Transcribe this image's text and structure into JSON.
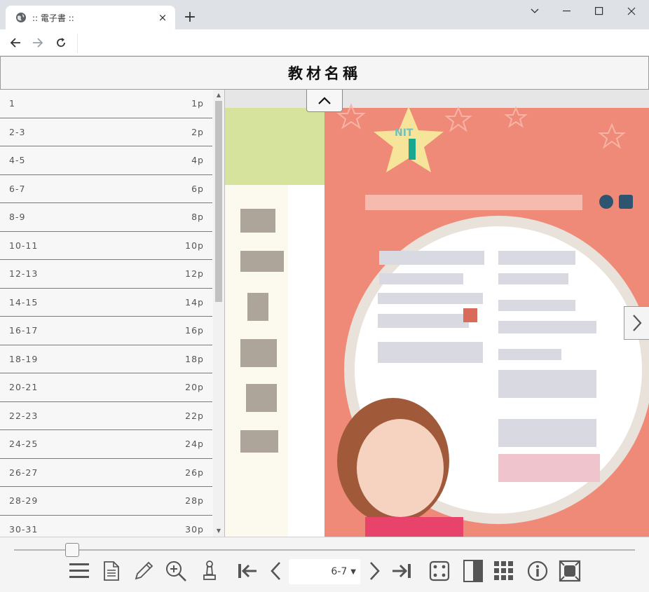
{
  "browser": {
    "tab_title": ":: 電子書 ::",
    "tab_close": "×",
    "new_tab": "+"
  },
  "header": {
    "title": "教材名稱"
  },
  "sidebar": {
    "pages": [
      {
        "range": "1",
        "page": "1p"
      },
      {
        "range": "2-3",
        "page": "2p"
      },
      {
        "range": "4-5",
        "page": "4p"
      },
      {
        "range": "6-7",
        "page": "6p"
      },
      {
        "range": "8-9",
        "page": "8p"
      },
      {
        "range": "10-11",
        "page": "10p"
      },
      {
        "range": "12-13",
        "page": "12p"
      },
      {
        "range": "14-15",
        "page": "14p"
      },
      {
        "range": "16-17",
        "page": "16p"
      },
      {
        "range": "18-19",
        "page": "18p"
      },
      {
        "range": "20-21",
        "page": "20p"
      },
      {
        "range": "22-23",
        "page": "22p"
      },
      {
        "range": "24-25",
        "page": "24p"
      },
      {
        "range": "26-27",
        "page": "26p"
      },
      {
        "range": "28-29",
        "page": "28p"
      },
      {
        "range": "30-31",
        "page": "30p"
      }
    ]
  },
  "viewer": {
    "unit_badge": "NIT",
    "unit_number": "1"
  },
  "bottombar": {
    "current_page": "6-7",
    "slider_position": 0.09,
    "tools": [
      "menu-icon",
      "document-icon",
      "pencil-icon",
      "zoom-in-icon",
      "bookmark-stamp-icon",
      "first-page-icon",
      "prev-page-icon",
      "next-page-icon",
      "last-page-icon",
      "dice-icon",
      "single-page-icon",
      "grid-icon",
      "info-icon",
      "fullscreen-icon"
    ]
  },
  "colors": {
    "page_background": "#f08a78",
    "green_strip": "#d5e39c",
    "accent_pink": "#e8436a"
  }
}
